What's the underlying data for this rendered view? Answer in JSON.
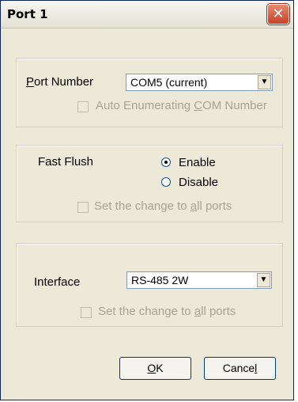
{
  "window": {
    "title": "Port 1",
    "close_icon": "✕"
  },
  "port_group": {
    "port_number_label": "Port Number",
    "port_value": "COM5 (current)",
    "auto_enum_label": "Auto Enumerating COM Number",
    "auto_enum_checked": false
  },
  "flush_group": {
    "label": "Fast Flush",
    "enable_label": "Enable",
    "disable_label": "Disable",
    "selected": "Enable",
    "apply_all_label": "Set the change to all ports",
    "apply_all_checked": false
  },
  "interface_group": {
    "label": "Interface",
    "value": "RS-485 2W",
    "apply_all_label": "Set the change to all ports",
    "apply_all_checked": false
  },
  "buttons": {
    "ok": "OK",
    "cancel": "Cancel"
  },
  "colors": {
    "dialog_bg": "#ece9d8",
    "close_button": "#c8402a"
  }
}
